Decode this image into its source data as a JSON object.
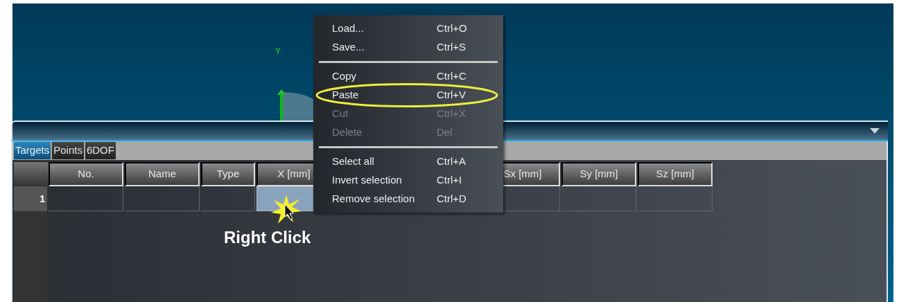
{
  "viewport": {
    "axis_label": "Y"
  },
  "panel": {
    "tabs": [
      {
        "label": "Targets",
        "selected": true
      },
      {
        "label": "Points",
        "selected": false
      },
      {
        "label": "6DOF",
        "selected": false
      }
    ],
    "table": {
      "columns": [
        "No.",
        "Name",
        "Type",
        "X [mm]",
        "Sx [mm]",
        "Sy [mm]",
        "Sz [mm]"
      ],
      "rows": [
        {
          "number": "1",
          "cells": [
            {
              "selected": false
            },
            {
              "selected": false
            },
            {
              "selected": false
            },
            {
              "selected": true
            },
            {
              "selected": false
            },
            {
              "selected": false
            },
            {
              "selected": false
            }
          ]
        }
      ]
    }
  },
  "context_menu": {
    "items": [
      {
        "kind": "item",
        "label": "Load...",
        "shortcut": "Ctrl+O",
        "disabled": false,
        "circled": false
      },
      {
        "kind": "item",
        "label": "Save...",
        "shortcut": "Ctrl+S",
        "disabled": false,
        "circled": false
      },
      {
        "kind": "separator"
      },
      {
        "kind": "item",
        "label": "Copy",
        "shortcut": "Ctrl+C",
        "disabled": false,
        "circled": false
      },
      {
        "kind": "item",
        "label": "Paste",
        "shortcut": "Ctrl+V",
        "disabled": false,
        "circled": true
      },
      {
        "kind": "item",
        "label": "Cut",
        "shortcut": "Ctrl+X",
        "disabled": true,
        "circled": false
      },
      {
        "kind": "item",
        "label": "Delete",
        "shortcut": "Del",
        "disabled": true,
        "circled": false
      },
      {
        "kind": "separator"
      },
      {
        "kind": "item",
        "label": "Select all",
        "shortcut": "Ctrl+A",
        "disabled": false,
        "circled": false
      },
      {
        "kind": "item",
        "label": "Invert selection",
        "shortcut": "Ctrl+I",
        "disabled": false,
        "circled": false
      },
      {
        "kind": "item",
        "label": "Remove selection",
        "shortcut": "Ctrl+D",
        "disabled": false,
        "circled": false
      }
    ]
  },
  "annotation": {
    "text": "Right Click"
  }
}
